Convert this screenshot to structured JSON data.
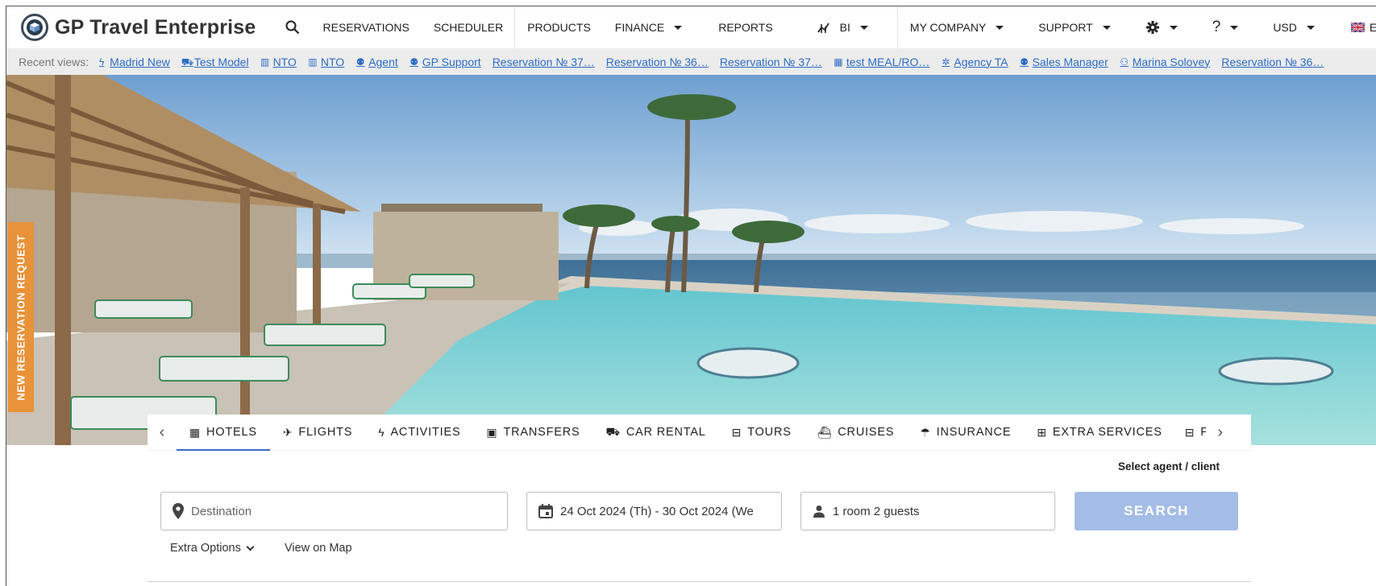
{
  "app": {
    "name": "GP Travel Enterprise"
  },
  "nav": {
    "items": [
      {
        "label": "RESERVATIONS",
        "caret": false
      },
      {
        "label": "SCHEDULER",
        "caret": false
      },
      {
        "label": "PRODUCTS",
        "caret": false
      },
      {
        "label": "FINANCE",
        "caret": true
      },
      {
        "label": "REPORTS",
        "caret": false
      },
      {
        "label": "BI",
        "caret": true,
        "icon": "bi-chart-icon"
      },
      {
        "label": "MY COMPANY",
        "caret": true
      },
      {
        "label": "SUPPORT",
        "caret": true
      },
      {
        "label": "",
        "caret": true,
        "icon": "gear-icon"
      },
      {
        "label": "?",
        "caret": true
      },
      {
        "label": "USD",
        "caret": true
      },
      {
        "label": "EN",
        "caret": true,
        "icon": "uk-flag-icon"
      }
    ]
  },
  "recent": {
    "label": "Recent views:",
    "items": [
      {
        "label": "Madrid New",
        "icon": "bolt-icon"
      },
      {
        "label": "Test Model",
        "icon": "car-icon"
      },
      {
        "label": "NTO",
        "icon": "building-icon"
      },
      {
        "label": "NTO",
        "icon": "building-icon"
      },
      {
        "label": "Agent",
        "icon": "people-icon"
      },
      {
        "label": "GP Support",
        "icon": "people-icon"
      },
      {
        "label": "Reservation № 37…",
        "icon": ""
      },
      {
        "label": "Reservation № 36…",
        "icon": ""
      },
      {
        "label": "Reservation № 37…",
        "icon": ""
      },
      {
        "label": "test MEAL/RO…",
        "icon": "hotel-icon"
      },
      {
        "label": "Agency TA",
        "icon": "gear-badge-icon"
      },
      {
        "label": "Sales Manager",
        "icon": "people-icon"
      },
      {
        "label": "Marina Solovey",
        "icon": "person-icon"
      },
      {
        "label": "Reservation № 36…",
        "icon": ""
      }
    ]
  },
  "side_tab": {
    "label": "NEW RESERVATION REQUEST"
  },
  "search": {
    "tabs": [
      {
        "label": "HOTELS",
        "icon": "hotel-icon",
        "active": true
      },
      {
        "label": "FLIGHTS",
        "icon": "plane-icon",
        "active": false
      },
      {
        "label": "ACTIVITIES",
        "icon": "bolt-icon",
        "active": false
      },
      {
        "label": "TRANSFERS",
        "icon": "bus-icon",
        "active": false
      },
      {
        "label": "CAR RENTAL",
        "icon": "car-icon",
        "active": false
      },
      {
        "label": "TOURS",
        "icon": "suitcase-icon",
        "active": false
      },
      {
        "label": "CRUISES",
        "icon": "ship-icon",
        "active": false
      },
      {
        "label": "INSURANCE",
        "icon": "umbrella-icon",
        "active": false
      },
      {
        "label": "EXTRA SERVICES",
        "icon": "plus-box-icon",
        "active": false
      },
      {
        "label": "P",
        "icon": "suitcase-icon",
        "active": false
      }
    ],
    "agent_link": "Select agent / client",
    "destination_placeholder": "Destination",
    "dates": "24 Oct 2024 (Th) -  30 Oct 2024 (We",
    "guests": "1 room 2 guests",
    "search_button": "SEARCH",
    "extra_options": "Extra Options",
    "view_on_map": "View on Map"
  },
  "colors": {
    "accent": "#3b6bc4",
    "search_button": "#a4bde6",
    "side_tab": "#e8923a",
    "link": "#2d6cc4",
    "recent_bar": "#ececec"
  }
}
